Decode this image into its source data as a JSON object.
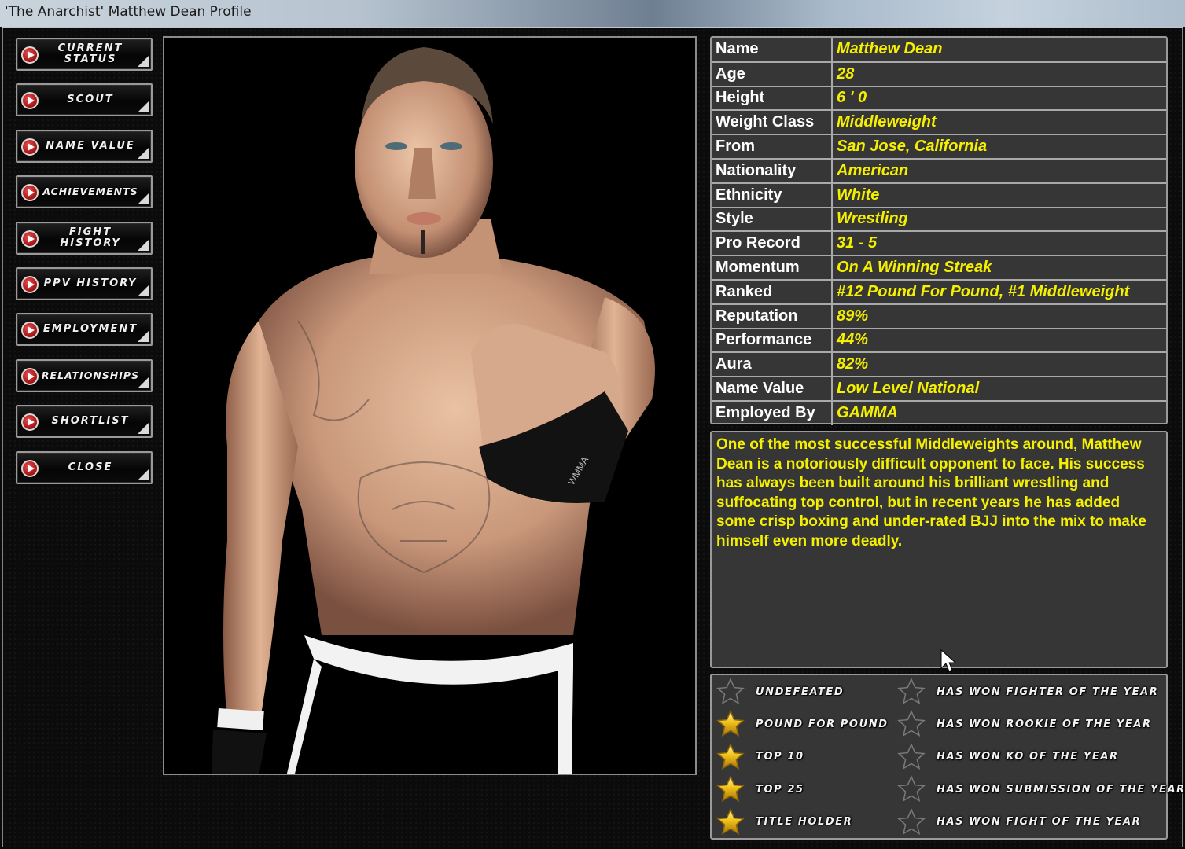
{
  "window": {
    "title": "'The Anarchist' Matthew Dean Profile"
  },
  "sidebar": {
    "items": [
      {
        "label": "CURRENT\nSTATUS",
        "icon": "play-arrow-icon"
      },
      {
        "label": "SCOUT",
        "icon": "play-arrow-icon"
      },
      {
        "label": "NAME VALUE",
        "icon": "play-arrow-icon"
      },
      {
        "label": "ACHIEVEMENTS",
        "icon": "play-arrow-icon"
      },
      {
        "label": "FIGHT\nHISTORY",
        "icon": "play-arrow-icon"
      },
      {
        "label": "PPV HISTORY",
        "icon": "play-arrow-icon"
      },
      {
        "label": "EMPLOYMENT",
        "icon": "play-arrow-icon"
      },
      {
        "label": "RELATIONSHIPS",
        "icon": "play-arrow-icon"
      },
      {
        "label": "SHORTLIST",
        "icon": "play-arrow-icon"
      },
      {
        "label": "CLOSE",
        "icon": "play-arrow-icon"
      }
    ]
  },
  "portrait": {
    "description": "3D render of fighter Matthew Dean, shirtless with tattoos, wearing black and white shorts and fingerless gloves",
    "glove_text": "WMMA"
  },
  "profile": {
    "rows": [
      {
        "label": "Name",
        "value": "Matthew Dean"
      },
      {
        "label": "Age",
        "value": "28"
      },
      {
        "label": "Height",
        "value": "6 ' 0"
      },
      {
        "label": "Weight Class",
        "value": "Middleweight"
      },
      {
        "label": "From",
        "value": "San Jose, California"
      },
      {
        "label": "Nationality",
        "value": "American"
      },
      {
        "label": "Ethnicity",
        "value": "White"
      },
      {
        "label": "Style",
        "value": "Wrestling"
      },
      {
        "label": "Pro Record",
        "value": "31 - 5"
      },
      {
        "label": "Momentum",
        "value": "On A Winning Streak"
      },
      {
        "label": "Ranked",
        "value": "#12 Pound For Pound, #1 Middleweight"
      },
      {
        "label": "Reputation",
        "value": "89%"
      },
      {
        "label": "Performance",
        "value": "44%"
      },
      {
        "label": "Aura",
        "value": "82%"
      },
      {
        "label": "Name Value",
        "value": "Low Level National"
      },
      {
        "label": "Employed By",
        "value": "GAMMA"
      }
    ]
  },
  "bio": {
    "text": "One of the most successful Middleweights around, Matthew Dean is a notoriously difficult opponent to face. His success has always been built around his brilliant wrestling and suffocating top control, but in recent years he has added some crisp boxing and under-rated BJJ into the mix to make himself even more deadly."
  },
  "achievements": {
    "left": [
      {
        "label": "UNDEFEATED",
        "earned": false
      },
      {
        "label": "POUND FOR POUND",
        "earned": true
      },
      {
        "label": "TOP 10",
        "earned": true
      },
      {
        "label": "TOP 25",
        "earned": true
      },
      {
        "label": "TITLE HOLDER",
        "earned": true
      }
    ],
    "right": [
      {
        "label": "HAS WON FIGHTER OF THE YEAR",
        "earned": false
      },
      {
        "label": "HAS WON ROOKIE OF THE YEAR",
        "earned": false
      },
      {
        "label": "HAS WON KO OF THE YEAR",
        "earned": false
      },
      {
        "label": "HAS WON SUBMISSION OF THE YEAR",
        "earned": false
      },
      {
        "label": "HAS WON FIGHT OF THE YEAR",
        "earned": false
      }
    ]
  },
  "colors": {
    "value_text": "#f5f000",
    "label_text": "#ffffff",
    "panel_bg": "#363636",
    "star_gold": "#f2c21a",
    "button_arrow_red": "#b01818"
  }
}
